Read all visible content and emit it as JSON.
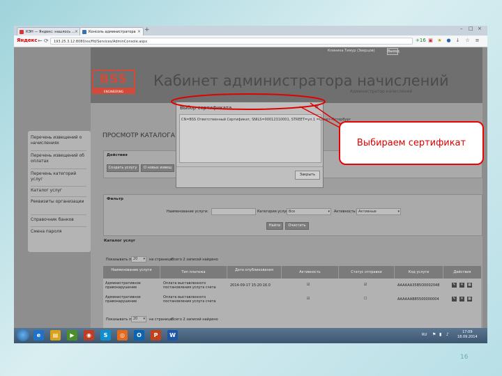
{
  "browser": {
    "tabs": [
      {
        "label": "КЭН — Яндекс: нашлось ...",
        "color": "#d33"
      },
      {
        "label": "Консоль администратора",
        "color": "#3a6fb0"
      }
    ],
    "new_tab": "+",
    "window_controls": [
      "–",
      "□",
      "×"
    ],
    "brand": "Яндекс",
    "address": "193.25.3.12:8080/xx/ffd/Services/AdminConsole.aspx",
    "nav": {
      "back": "←",
      "forward": "→",
      "reload": "⟳",
      "home": "⌂"
    },
    "toolbar_badge": "+16"
  },
  "header": {
    "user": "Клиника Тимур (Зверцов)",
    "exit_label": "Выход",
    "logo_text": "BSS",
    "logo_sub": "ENGINEERING",
    "app_title": "Кабинет администратора начислений",
    "app_subtitle": "Администратор начислений"
  },
  "sidebar": {
    "items": [
      {
        "label": "Перечень извещений о начислениях"
      },
      {
        "label": "Перечень извещений об оплатах"
      },
      {
        "label": "Перечень категорий услуг"
      },
      {
        "label": "Каталог услуг"
      },
      {
        "label": "Реквизиты организации"
      },
      {
        "label": "Справочник банков"
      },
      {
        "label": "Смена пароля"
      }
    ]
  },
  "main": {
    "section_title": "ПРОСМОТР КАТАЛОГА",
    "actions": {
      "title": "Действия",
      "create_label": "Создать услугу",
      "load_label": "О новых извещ"
    },
    "filter": {
      "title": "Фильтр",
      "name_label": "Наименование услуги:",
      "name_value": "",
      "category_label": "Категория услуг:",
      "category_value": "Все",
      "activity_label": "Активность:",
      "activity_value": "Активные",
      "find_label": "Найти",
      "clear_label": "Очистить"
    },
    "catalog": {
      "title": "Каталог услуг",
      "show_label": "Показывать по",
      "page_size": "20",
      "per_page_label": "на странице",
      "total_label": "Всего 2 записей найдено",
      "columns": [
        "Наименование услуги",
        "Тип платежа",
        "Дата опубликования",
        "Активность",
        "Статус отправки",
        "Код услуги",
        "Действия"
      ],
      "rows": [
        {
          "name": "Административное правонарушение",
          "type": "Оплата выставленного постановления услуга счета",
          "date": "2014-09-17 15:20:16.0",
          "active": "☑",
          "status": "☑",
          "code": "AAAAAA35B5O0002048"
        },
        {
          "name": "Административное правонарушение",
          "type": "Оплата выставленного постановления услуга счета",
          "date": "",
          "active": "☑",
          "status": "☐",
          "code": "AAAAAAB85500000004"
        }
      ]
    }
  },
  "dialog": {
    "title": "Выбор сертификата",
    "close": "×",
    "item": "CN=BSS Ответственный Сертификат, SNILS=00012310001, STREET=ул.1 =Санкт-Петербург",
    "cancel_label": "Закрыть"
  },
  "annotation": {
    "text": "Выбираем сертификат",
    "color": "#e00000"
  },
  "taskbar": {
    "icons": [
      "e",
      "▤",
      "▶",
      "◉",
      "S",
      "◎",
      "O",
      "P",
      "W"
    ],
    "icon_colors": [
      "#1e73c9",
      "#d9a21b",
      "#4b8f2a",
      "#c23b22",
      "#0f8fd0",
      "#e66a1d",
      "#0a64b4",
      "#c3421b",
      "#1d56a6"
    ],
    "time": "17:09",
    "date": "18.09.2014",
    "lang": "RU"
  },
  "slide": {
    "page_number": "16"
  }
}
